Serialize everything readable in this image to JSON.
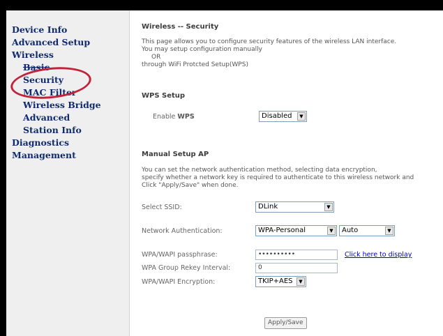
{
  "sidebar": {
    "device_info": "Device Info",
    "advanced_setup": "Advanced Setup",
    "wireless": "Wireless",
    "basic": "Basic",
    "security": "Security",
    "mac_filter": "MAC Filter",
    "wireless_bridge": "Wireless Bridge",
    "advanced": "Advanced",
    "station_info": "Station Info",
    "diagnostics": "Diagnostics",
    "management": "Management"
  },
  "page": {
    "title": "Wireless -- Security",
    "intro_line1": "This page allows you to configure security features of the wireless LAN interface.",
    "intro_line2": "You may setup configuration manually",
    "intro_or": "OR",
    "intro_line3": "through WiFi Protcted Setup(WPS)"
  },
  "wps": {
    "heading": "WPS Setup",
    "enable_label_prefix": "Enable ",
    "enable_label_bold": "WPS",
    "enable_value": "Disabled"
  },
  "manual": {
    "heading": "Manual Setup AP",
    "desc_line1": "You can set the network authentication method, selecting data encryption,",
    "desc_line2": "specify whether a network key is required to authenticate to this wireless network and",
    "desc_line3": "Click \"Apply/Save\" when done.",
    "ssid_label": "Select SSID:",
    "ssid_value": "DLink",
    "auth_label": "Network Authentication:",
    "auth_value": "WPA-Personal",
    "auth_mode_value": "Auto",
    "passphrase_label": "WPA/WAPI passphrase:",
    "passphrase_value": "••••••••••",
    "display_link": "Click here to display",
    "rekey_label": "WPA Group Rekey Interval:",
    "rekey_value": "0",
    "encryption_label": "WPA/WAPI Encryption:",
    "encryption_value": "TKIP+AES"
  },
  "apply_label": "Apply/Save",
  "colors": {
    "nav_text": "#0f2a6e",
    "highlight_ring": "#c0233a",
    "link": "#0000cc"
  }
}
